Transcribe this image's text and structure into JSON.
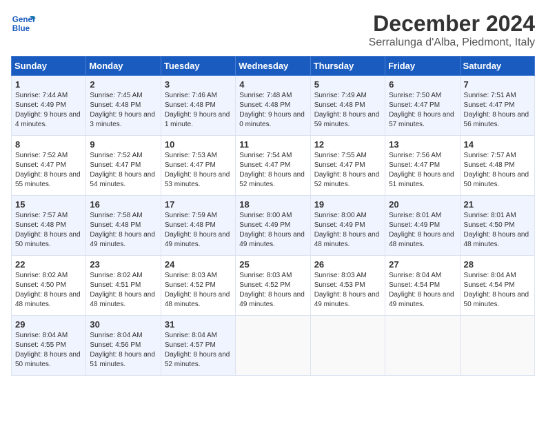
{
  "header": {
    "logo_line1": "General",
    "logo_line2": "Blue",
    "month": "December 2024",
    "location": "Serralunga d'Alba, Piedmont, Italy"
  },
  "weekdays": [
    "Sunday",
    "Monday",
    "Tuesday",
    "Wednesday",
    "Thursday",
    "Friday",
    "Saturday"
  ],
  "weeks": [
    [
      {
        "day": "1",
        "sunrise": "Sunrise: 7:44 AM",
        "sunset": "Sunset: 4:49 PM",
        "daylight": "Daylight: 9 hours and 4 minutes."
      },
      {
        "day": "2",
        "sunrise": "Sunrise: 7:45 AM",
        "sunset": "Sunset: 4:48 PM",
        "daylight": "Daylight: 9 hours and 3 minutes."
      },
      {
        "day": "3",
        "sunrise": "Sunrise: 7:46 AM",
        "sunset": "Sunset: 4:48 PM",
        "daylight": "Daylight: 9 hours and 1 minute."
      },
      {
        "day": "4",
        "sunrise": "Sunrise: 7:48 AM",
        "sunset": "Sunset: 4:48 PM",
        "daylight": "Daylight: 9 hours and 0 minutes."
      },
      {
        "day": "5",
        "sunrise": "Sunrise: 7:49 AM",
        "sunset": "Sunset: 4:48 PM",
        "daylight": "Daylight: 8 hours and 59 minutes."
      },
      {
        "day": "6",
        "sunrise": "Sunrise: 7:50 AM",
        "sunset": "Sunset: 4:47 PM",
        "daylight": "Daylight: 8 hours and 57 minutes."
      },
      {
        "day": "7",
        "sunrise": "Sunrise: 7:51 AM",
        "sunset": "Sunset: 4:47 PM",
        "daylight": "Daylight: 8 hours and 56 minutes."
      }
    ],
    [
      {
        "day": "8",
        "sunrise": "Sunrise: 7:52 AM",
        "sunset": "Sunset: 4:47 PM",
        "daylight": "Daylight: 8 hours and 55 minutes."
      },
      {
        "day": "9",
        "sunrise": "Sunrise: 7:52 AM",
        "sunset": "Sunset: 4:47 PM",
        "daylight": "Daylight: 8 hours and 54 minutes."
      },
      {
        "day": "10",
        "sunrise": "Sunrise: 7:53 AM",
        "sunset": "Sunset: 4:47 PM",
        "daylight": "Daylight: 8 hours and 53 minutes."
      },
      {
        "day": "11",
        "sunrise": "Sunrise: 7:54 AM",
        "sunset": "Sunset: 4:47 PM",
        "daylight": "Daylight: 8 hours and 52 minutes."
      },
      {
        "day": "12",
        "sunrise": "Sunrise: 7:55 AM",
        "sunset": "Sunset: 4:47 PM",
        "daylight": "Daylight: 8 hours and 52 minutes."
      },
      {
        "day": "13",
        "sunrise": "Sunrise: 7:56 AM",
        "sunset": "Sunset: 4:47 PM",
        "daylight": "Daylight: 8 hours and 51 minutes."
      },
      {
        "day": "14",
        "sunrise": "Sunrise: 7:57 AM",
        "sunset": "Sunset: 4:48 PM",
        "daylight": "Daylight: 8 hours and 50 minutes."
      }
    ],
    [
      {
        "day": "15",
        "sunrise": "Sunrise: 7:57 AM",
        "sunset": "Sunset: 4:48 PM",
        "daylight": "Daylight: 8 hours and 50 minutes."
      },
      {
        "day": "16",
        "sunrise": "Sunrise: 7:58 AM",
        "sunset": "Sunset: 4:48 PM",
        "daylight": "Daylight: 8 hours and 49 minutes."
      },
      {
        "day": "17",
        "sunrise": "Sunrise: 7:59 AM",
        "sunset": "Sunset: 4:48 PM",
        "daylight": "Daylight: 8 hours and 49 minutes."
      },
      {
        "day": "18",
        "sunrise": "Sunrise: 8:00 AM",
        "sunset": "Sunset: 4:49 PM",
        "daylight": "Daylight: 8 hours and 49 minutes."
      },
      {
        "day": "19",
        "sunrise": "Sunrise: 8:00 AM",
        "sunset": "Sunset: 4:49 PM",
        "daylight": "Daylight: 8 hours and 48 minutes."
      },
      {
        "day": "20",
        "sunrise": "Sunrise: 8:01 AM",
        "sunset": "Sunset: 4:49 PM",
        "daylight": "Daylight: 8 hours and 48 minutes."
      },
      {
        "day": "21",
        "sunrise": "Sunrise: 8:01 AM",
        "sunset": "Sunset: 4:50 PM",
        "daylight": "Daylight: 8 hours and 48 minutes."
      }
    ],
    [
      {
        "day": "22",
        "sunrise": "Sunrise: 8:02 AM",
        "sunset": "Sunset: 4:50 PM",
        "daylight": "Daylight: 8 hours and 48 minutes."
      },
      {
        "day": "23",
        "sunrise": "Sunrise: 8:02 AM",
        "sunset": "Sunset: 4:51 PM",
        "daylight": "Daylight: 8 hours and 48 minutes."
      },
      {
        "day": "24",
        "sunrise": "Sunrise: 8:03 AM",
        "sunset": "Sunset: 4:52 PM",
        "daylight": "Daylight: 8 hours and 48 minutes."
      },
      {
        "day": "25",
        "sunrise": "Sunrise: 8:03 AM",
        "sunset": "Sunset: 4:52 PM",
        "daylight": "Daylight: 8 hours and 49 minutes."
      },
      {
        "day": "26",
        "sunrise": "Sunrise: 8:03 AM",
        "sunset": "Sunset: 4:53 PM",
        "daylight": "Daylight: 8 hours and 49 minutes."
      },
      {
        "day": "27",
        "sunrise": "Sunrise: 8:04 AM",
        "sunset": "Sunset: 4:54 PM",
        "daylight": "Daylight: 8 hours and 49 minutes."
      },
      {
        "day": "28",
        "sunrise": "Sunrise: 8:04 AM",
        "sunset": "Sunset: 4:54 PM",
        "daylight": "Daylight: 8 hours and 50 minutes."
      }
    ],
    [
      {
        "day": "29",
        "sunrise": "Sunrise: 8:04 AM",
        "sunset": "Sunset: 4:55 PM",
        "daylight": "Daylight: 8 hours and 50 minutes."
      },
      {
        "day": "30",
        "sunrise": "Sunrise: 8:04 AM",
        "sunset": "Sunset: 4:56 PM",
        "daylight": "Daylight: 8 hours and 51 minutes."
      },
      {
        "day": "31",
        "sunrise": "Sunrise: 8:04 AM",
        "sunset": "Sunset: 4:57 PM",
        "daylight": "Daylight: 8 hours and 52 minutes."
      },
      null,
      null,
      null,
      null
    ]
  ]
}
